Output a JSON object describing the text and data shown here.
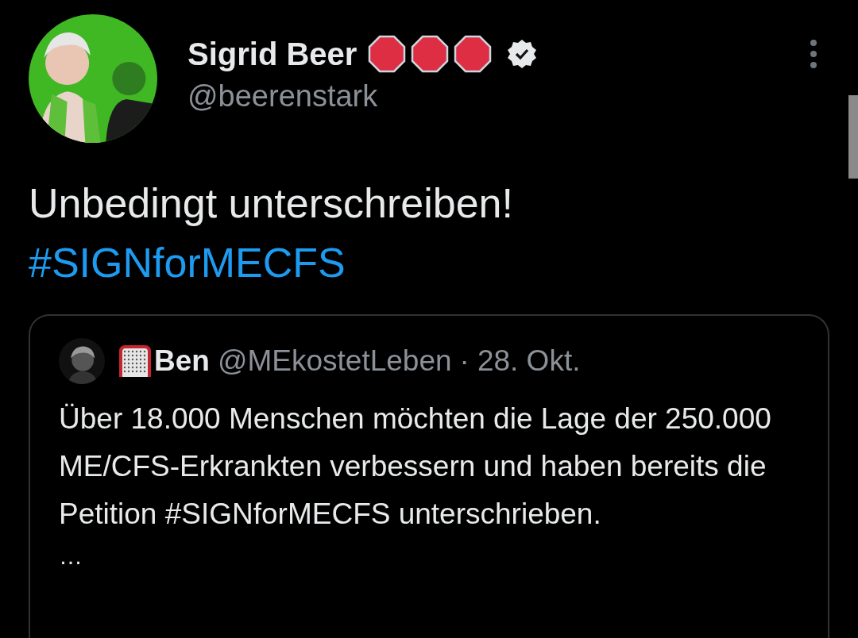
{
  "author": {
    "name": "Sigrid Beer",
    "badges": [
      {
        "kind": "stop"
      },
      {
        "kind": "stop"
      },
      {
        "kind": "stop"
      },
      {
        "kind": "verified"
      }
    ],
    "handle": "@beerenstark"
  },
  "tweet": {
    "text": "Unbedingt unterschreiben!",
    "hashtag": "#SIGNforMECFS"
  },
  "quoted": {
    "badge": {
      "kind": "net"
    },
    "name": "Ben",
    "handle": "@MEkostetLeben",
    "separator": "·",
    "date": "28. Okt.",
    "text": "Über 18.000 Menschen möchten die Lage der 250.000 ME/CFS-Erkrankten verbessern und haben bereits die Petition #SIGNforMECFS unterschrieben.",
    "more": "…"
  }
}
